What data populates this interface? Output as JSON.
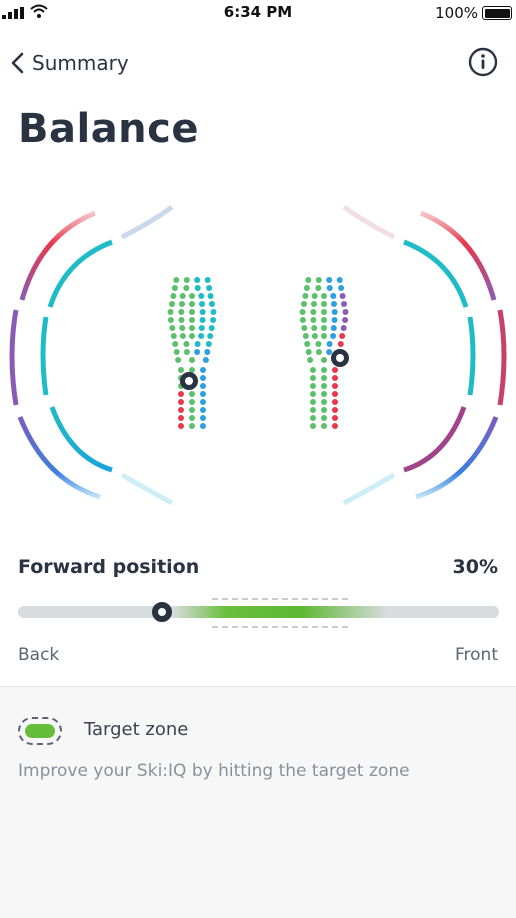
{
  "status_bar": {
    "time": "6:34 PM",
    "battery": "100%"
  },
  "nav": {
    "back_label": "Summary",
    "back_icon": "chevron-left-icon",
    "info_icon": "info-icon"
  },
  "title": "Balance",
  "forward_position": {
    "label": "Forward position",
    "value_text": "30%",
    "value": 0.3,
    "target_zone_start": 0.32,
    "target_zone_end": 0.77,
    "back_label": "Back",
    "front_label": "Front"
  },
  "target_zone": {
    "title": "Target zone",
    "description": "Improve your Ski:IQ by hitting the target zone"
  },
  "colors": {
    "text_dark": "#2a3342",
    "green": "#5cc06a",
    "blue": "#2e9fe0",
    "teal": "#1fbcc8",
    "red": "#e8384b",
    "purple": "#8a5bb5",
    "zone_green": "#64be3a"
  }
}
